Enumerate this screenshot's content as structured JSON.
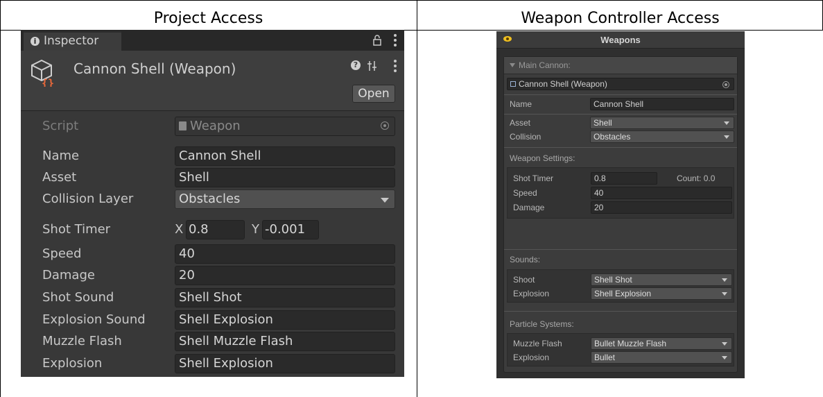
{
  "table": {
    "col1_header": "Project Access",
    "col2_header": "Weapon Controller Access"
  },
  "inspector": {
    "tab_label": "Inspector",
    "title": "Cannon Shell (Weapon)",
    "open_label": "Open",
    "script_label": "Script",
    "script_value": "Weapon",
    "fields": {
      "name_label": "Name",
      "name_value": "Cannon Shell",
      "asset_label": "Asset",
      "asset_value": "Shell",
      "collision_label": "Collision Layer",
      "collision_value": "Obstacles",
      "shot_timer_label": "Shot Timer",
      "shot_timer_x_label": "X",
      "shot_timer_x": "0.8",
      "shot_timer_y_label": "Y",
      "shot_timer_y": "-0.001",
      "speed_label": "Speed",
      "speed_value": "40",
      "damage_label": "Damage",
      "damage_value": "20",
      "shot_sound_label": "Shot Sound",
      "shot_sound_value": "Shell Shot",
      "explosion_sound_label": "Explosion Sound",
      "explosion_sound_value": "Shell Explosion",
      "muzzle_flash_label": "Muzzle Flash",
      "muzzle_flash_value": "Shell Muzzle Flash",
      "explosion_label": "Explosion",
      "explosion_value": "Shell Explosion"
    },
    "icons": [
      "info-icon",
      "lock-icon",
      "kebab-menu-icon",
      "scriptable-object-icon",
      "help-icon",
      "preset-icon",
      "object-picker-icon"
    ]
  },
  "weapons_panel": {
    "title": "Weapons",
    "section_header": "Main Cannon:",
    "object_field": "Cannon Shell (Weapon)",
    "name_label": "Name",
    "name_value": "Cannon Shell",
    "asset_label": "Asset",
    "asset_value": "Shell",
    "collision_label": "Collision",
    "collision_value": "Obstacles",
    "weapon_settings_header": "Weapon Settings:",
    "shot_timer_label": "Shot Timer",
    "shot_timer_value": "0.8",
    "count_text": "Count: 0.0",
    "speed_label": "Speed",
    "speed_value": "40",
    "damage_label": "Damage",
    "damage_value": "20",
    "sounds_header": "Sounds:",
    "shoot_label": "Shoot",
    "shoot_value": "Shell Shot",
    "sound_explosion_label": "Explosion",
    "sound_explosion_value": "Shell Explosion",
    "particles_header": "Particle Systems:",
    "muzzle_label": "Muzzle Flash",
    "muzzle_value": "Bullet Muzzle Flash",
    "particle_explosion_label": "Explosion",
    "particle_explosion_value": "Bullet"
  },
  "colors": {
    "inspector_bg": "#383838",
    "field_bg": "#2a2a2a",
    "accent_orange": "#e8683a",
    "accent_blue": "#9bb3d6"
  }
}
